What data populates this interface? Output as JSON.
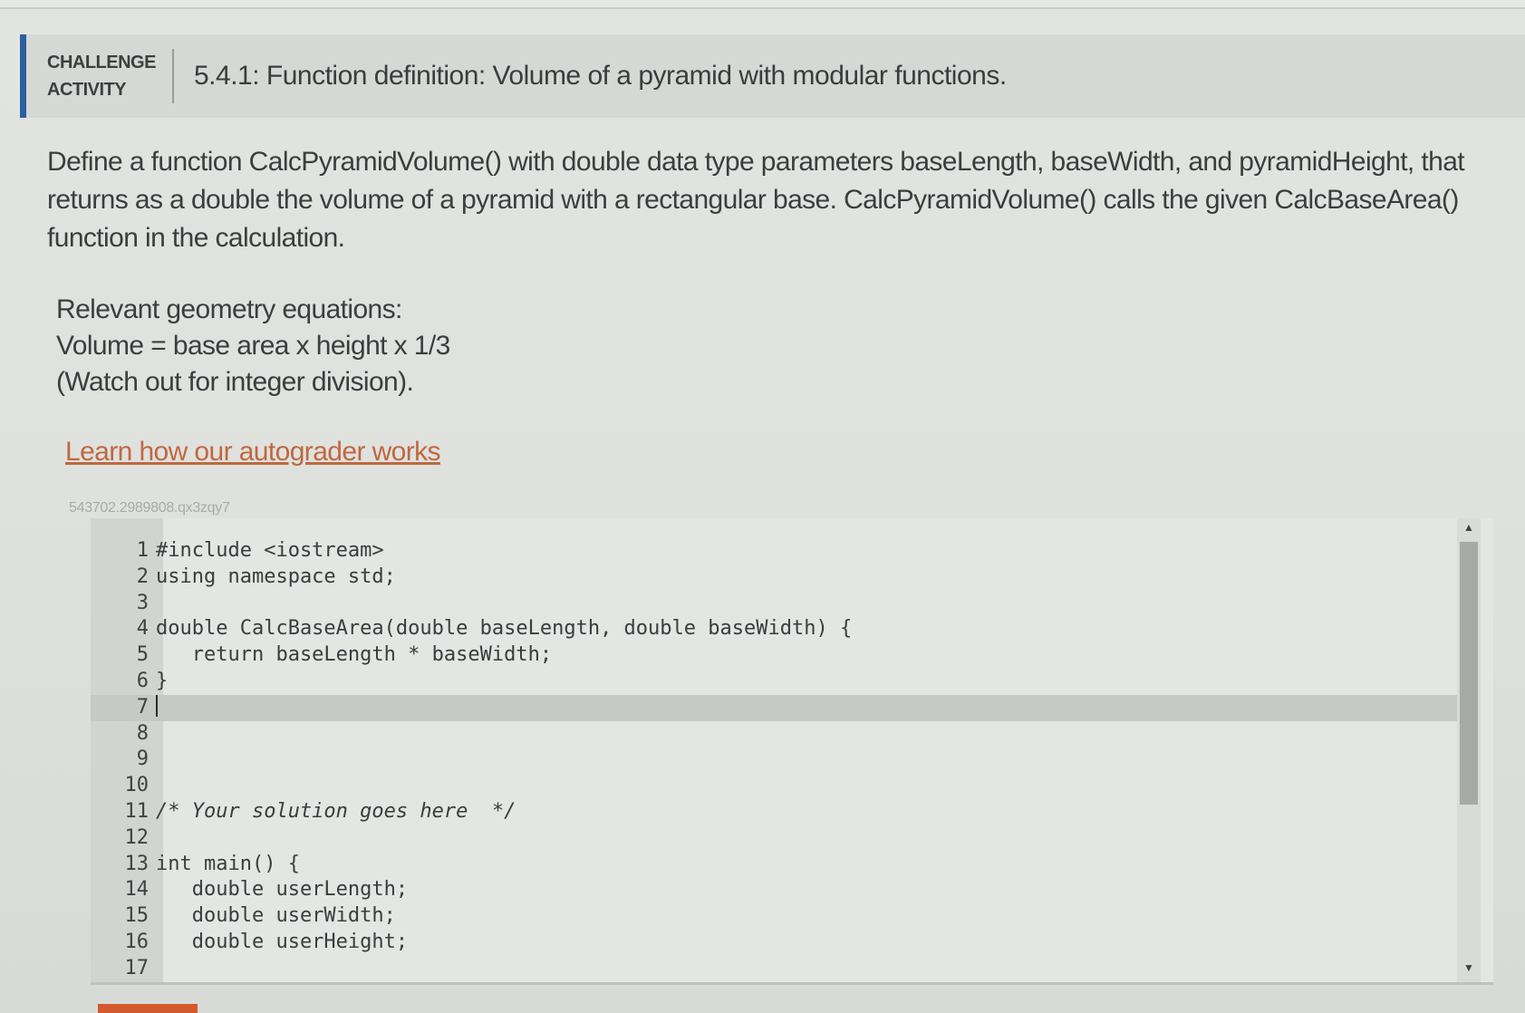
{
  "header": {
    "badge_line1": "CHALLENGE",
    "badge_line2": "ACTIVITY",
    "title": "5.4.1: Function definition: Volume of a pyramid with modular functions."
  },
  "description": "Define a function CalcPyramidVolume() with double data type parameters baseLength, baseWidth, and pyramidHeight, that returns as a double the volume of a pyramid with a rectangular base. CalcPyramidVolume() calls the given CalcBaseArea() function in the calculation.",
  "equations": {
    "heading": "Relevant geometry equations:",
    "formula": "Volume = base area x height x 1/3",
    "note": "(Watch out for integer division)."
  },
  "autograder_link": "Learn how our autograder works",
  "activity_id": "543702.2989808.qx3zqy7",
  "editor": {
    "active_line": 7,
    "lines": [
      {
        "num": "1",
        "code": "#include <iostream>"
      },
      {
        "num": "2",
        "code": "using namespace std;"
      },
      {
        "num": "3",
        "code": ""
      },
      {
        "num": "4",
        "code": "double CalcBaseArea(double baseLength, double baseWidth) {"
      },
      {
        "num": "5",
        "code": "   return baseLength * baseWidth;"
      },
      {
        "num": "6",
        "code": "}"
      },
      {
        "num": "7",
        "code": ""
      },
      {
        "num": "8",
        "code": ""
      },
      {
        "num": "9",
        "code": ""
      },
      {
        "num": "10",
        "code": ""
      },
      {
        "num": "11",
        "code": "/* Your solution goes here  */"
      },
      {
        "num": "12",
        "code": ""
      },
      {
        "num": "13",
        "code": "int main() {"
      },
      {
        "num": "14",
        "code": "   double userLength;"
      },
      {
        "num": "15",
        "code": "   double userWidth;"
      },
      {
        "num": "16",
        "code": "   double userHeight;"
      },
      {
        "num": "17",
        "code": ""
      }
    ]
  },
  "scrollbar": {
    "up_icon": "▲",
    "down_icon": "▼",
    "position_fraction": 0.0
  },
  "colors": {
    "accent_bar": "#2b5f9e",
    "link": "#c0673f",
    "run_button": "#d35a2c"
  }
}
